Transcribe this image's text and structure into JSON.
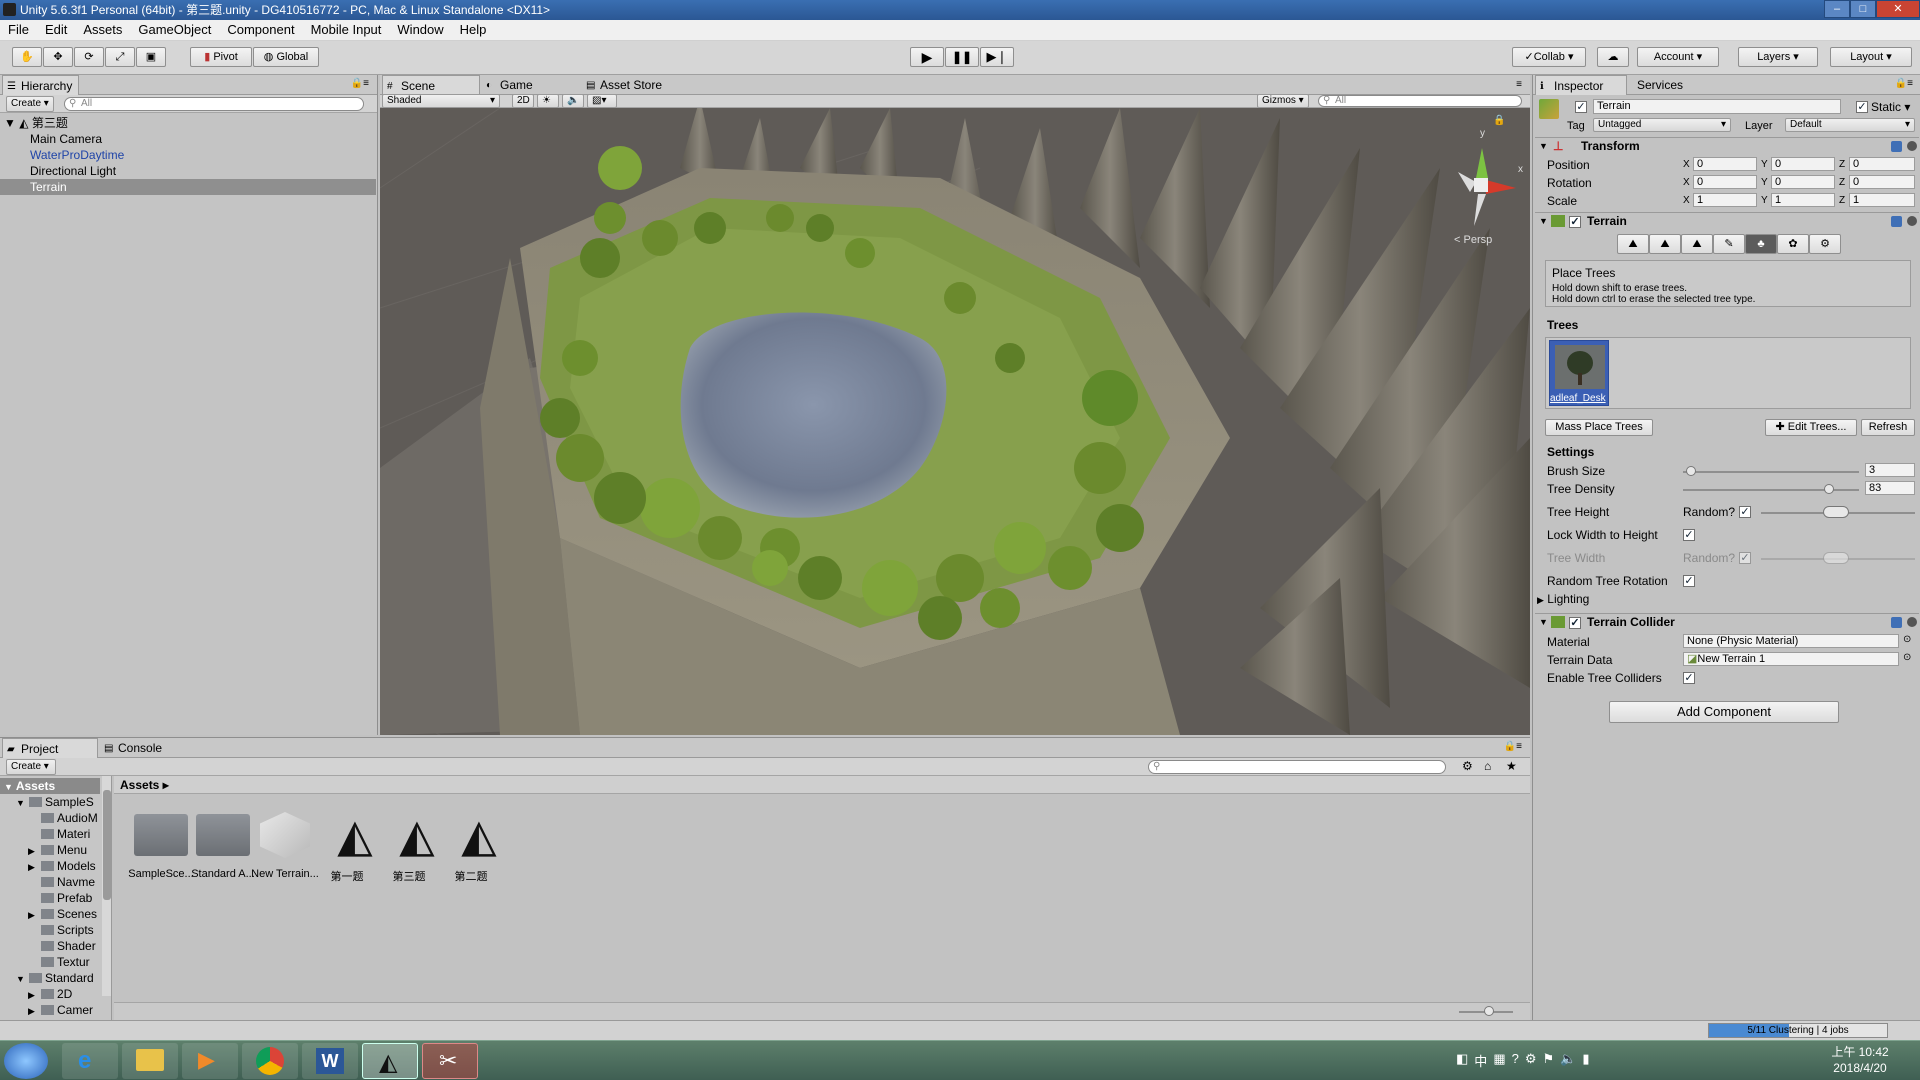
{
  "window": {
    "title": "Unity 5.6.3f1 Personal (64bit) - 第三题.unity - DG410516772 - PC, Mac & Linux Standalone <DX11>"
  },
  "menu": [
    "File",
    "Edit",
    "Assets",
    "GameObject",
    "Component",
    "Mobile Input",
    "Window",
    "Help"
  ],
  "toolbar": {
    "pivot": "Pivot",
    "global": "Global",
    "collab": "Collab",
    "account": "Account",
    "layers": "Layers",
    "layout": "Layout"
  },
  "hierarchy": {
    "tab": "Hierarchy",
    "create": "Create",
    "search_placeholder": "All",
    "scene_name": "第三题",
    "items": [
      "Main Camera",
      "WaterProDaytime",
      "Directional Light",
      "Terrain"
    ],
    "selected": "Terrain"
  },
  "scene": {
    "tabs": [
      "Scene",
      "Game",
      "Asset Store"
    ],
    "shading": "Shaded",
    "mode_2d": "2D",
    "gizmos": "Gizmos",
    "search_placeholder": "All",
    "persp": "Persp",
    "axis_labels": [
      "y",
      "x"
    ]
  },
  "inspector": {
    "tabs": [
      "Inspector",
      "Services"
    ],
    "object_name": "Terrain",
    "static_label": "Static",
    "tag_label": "Tag",
    "tag_value": "Untagged",
    "layer_label": "Layer",
    "layer_value": "Default",
    "transform": {
      "title": "Transform",
      "position_label": "Position",
      "rotation_label": "Rotation",
      "scale_label": "Scale",
      "axes": [
        "X",
        "Y",
        "Z"
      ],
      "position": [
        "0",
        "0",
        "0"
      ],
      "rotation": [
        "0",
        "0",
        "0"
      ],
      "scale": [
        "1",
        "1",
        "1"
      ]
    },
    "terrain": {
      "title": "Terrain",
      "help_title": "Place Trees",
      "help_line1": "Hold down shift to erase trees.",
      "help_line2": "Hold down ctrl to erase the selected tree type.",
      "trees_label": "Trees",
      "tree_name": "adleaf_Desk",
      "mass_place": "Mass Place Trees",
      "edit_trees": "Edit Trees...",
      "refresh": "Refresh",
      "settings_label": "Settings",
      "brush_size_label": "Brush Size",
      "brush_size": "3",
      "brush_size_fraction": 0.03,
      "tree_density_label": "Tree Density",
      "tree_density": "83",
      "tree_density_fraction": 0.83,
      "tree_height_label": "Tree Height",
      "random_label": "Random?",
      "lock_width_label": "Lock Width to Height",
      "tree_width_label": "Tree Width",
      "random_rotation_label": "Random Tree Rotation",
      "lighting_label": "Lighting"
    },
    "collider": {
      "title": "Terrain Collider",
      "material_label": "Material",
      "material_value": "None (Physic Material)",
      "terrain_data_label": "Terrain Data",
      "terrain_data_value": "New Terrain 1",
      "enable_tree_label": "Enable Tree Colliders"
    },
    "add_component": "Add Component"
  },
  "project": {
    "tabs": [
      "Project",
      "Console"
    ],
    "create": "Create",
    "breadcrumb": "Assets",
    "tree_root": "Assets",
    "tree": [
      {
        "label": "SampleS",
        "indent": 1,
        "open": true
      },
      {
        "label": "AudioM",
        "indent": 2
      },
      {
        "label": "Materi",
        "indent": 2
      },
      {
        "label": "Menu",
        "indent": 2,
        "arrow": true
      },
      {
        "label": "Models",
        "indent": 2,
        "arrow": true
      },
      {
        "label": "Navme",
        "indent": 2
      },
      {
        "label": "Prefab",
        "indent": 2
      },
      {
        "label": "Scenes",
        "indent": 2,
        "arrow": true
      },
      {
        "label": "Scripts",
        "indent": 2
      },
      {
        "label": "Shader",
        "indent": 2
      },
      {
        "label": "Textur",
        "indent": 2
      },
      {
        "label": "Standard",
        "indent": 1,
        "open": true
      },
      {
        "label": "2D",
        "indent": 2,
        "arrow": true
      },
      {
        "label": "Camer",
        "indent": 2,
        "arrow": true
      }
    ],
    "assets": [
      {
        "label": "SampleSce...",
        "kind": "folder"
      },
      {
        "label": "Standard A...",
        "kind": "folder"
      },
      {
        "label": "New Terrain...",
        "kind": "terrain"
      },
      {
        "label": "第一题",
        "kind": "unity"
      },
      {
        "label": "第三题",
        "kind": "unity"
      },
      {
        "label": "第二题",
        "kind": "unity"
      }
    ]
  },
  "status": {
    "progress_text": "5/11 Clustering | 4 jobs",
    "progress_fraction": 0.45
  },
  "taskbar": {
    "time": "上午 10:42",
    "date": "2018/4/20",
    "ime": "中"
  }
}
